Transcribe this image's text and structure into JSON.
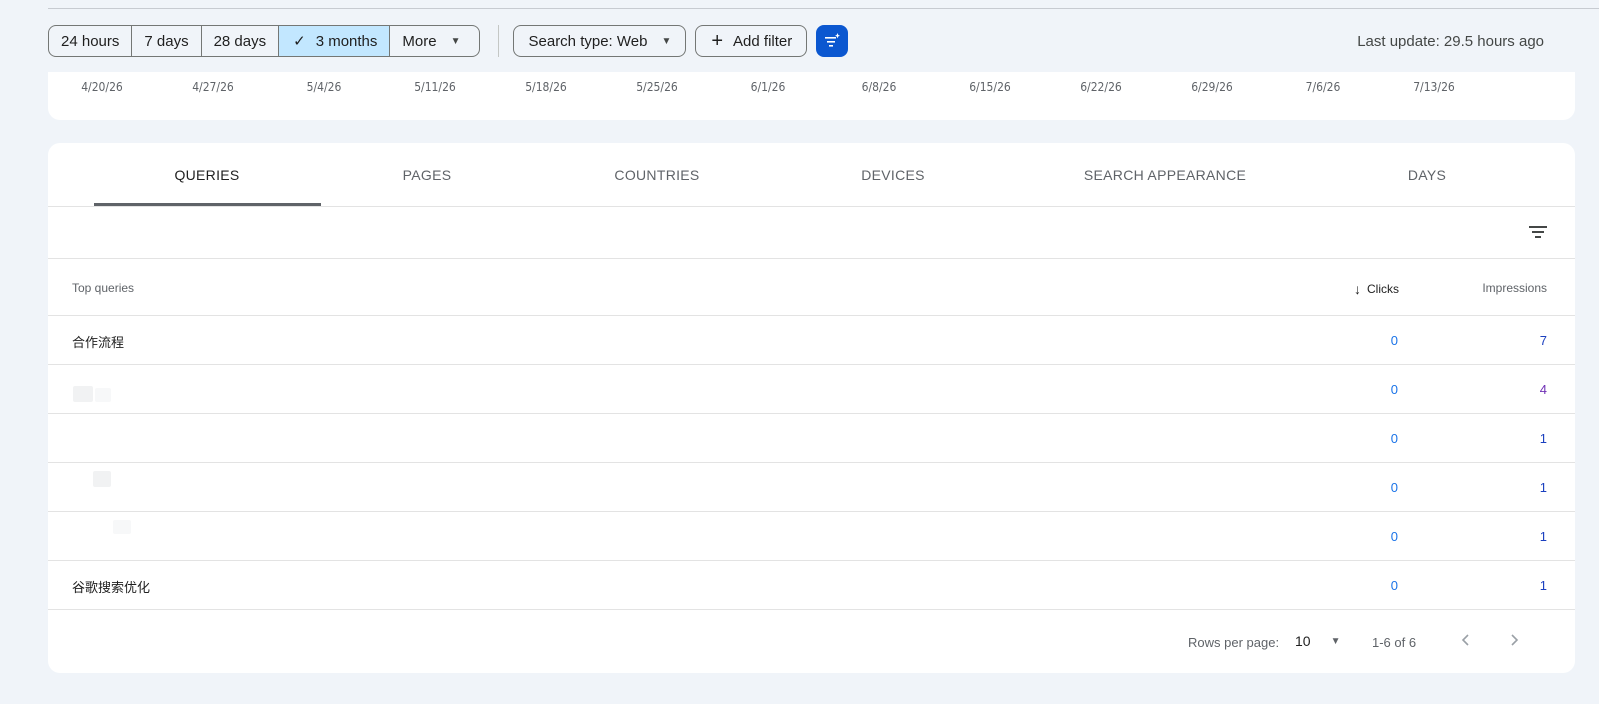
{
  "toolbar": {
    "ranges": [
      {
        "label": "24 hours",
        "selected": false
      },
      {
        "label": "7 days",
        "selected": false
      },
      {
        "label": "28 days",
        "selected": false
      },
      {
        "label": "3 months",
        "selected": true
      },
      {
        "label": "More",
        "selected": false
      }
    ],
    "search_type": "Search type: Web",
    "add_filter": "Add filter",
    "last_update": "Last update: 29.5 hours ago"
  },
  "axis": {
    "dates": [
      "4/20/26",
      "4/27/26",
      "5/4/26",
      "5/11/26",
      "5/18/26",
      "5/25/26",
      "6/1/26",
      "6/8/26",
      "6/15/26",
      "6/22/26",
      "6/29/26",
      "7/6/26",
      "7/13/26"
    ]
  },
  "tabs": [
    "QUERIES",
    "PAGES",
    "COUNTRIES",
    "DEVICES",
    "SEARCH APPEARANCE",
    "DAYS"
  ],
  "active_tab": "QUERIES",
  "table": {
    "columns": {
      "query": "Top queries",
      "clicks": "Clicks",
      "impressions": "Impressions"
    },
    "sort": "clicks-desc",
    "rows": [
      {
        "query": "合作流程",
        "clicks": "0",
        "impressions": "7"
      },
      {
        "query": "",
        "clicks": "0",
        "impressions": "4"
      },
      {
        "query": "",
        "clicks": "0",
        "impressions": "1"
      },
      {
        "query": "",
        "clicks": "0",
        "impressions": "1"
      },
      {
        "query": "",
        "clicks": "0",
        "impressions": "1"
      },
      {
        "query": "谷歌搜索优化",
        "clicks": "0",
        "impressions": "1"
      }
    ]
  },
  "pagination": {
    "rows_per_page_label": "Rows per page:",
    "rows_per_page": "10",
    "range": "1-6 of 6"
  },
  "colors": {
    "accent": "#0b57d0",
    "selected_chip": "#c2e7ff",
    "clicks": "#1a73e8",
    "impressions": "#1a3fbf"
  }
}
